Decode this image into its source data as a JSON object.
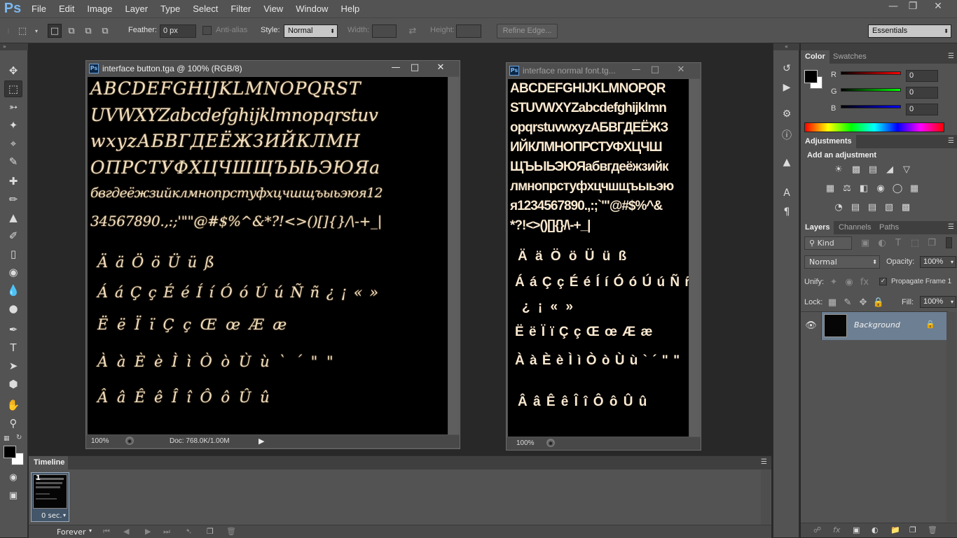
{
  "app": {
    "logo": "Ps"
  },
  "menu": [
    "File",
    "Edit",
    "Image",
    "Layer",
    "Type",
    "Select",
    "Filter",
    "View",
    "Window",
    "Help"
  ],
  "options": {
    "feather_label": "Feather:",
    "feather_value": "0 px",
    "antialias_label": "Anti-alias",
    "style_label": "Style:",
    "style_value": "Normal",
    "width_label": "Width:",
    "height_label": "Height:",
    "refine_edge": "Refine Edge...",
    "workspace": "Essentials"
  },
  "doc1": {
    "title": "interface button.tga @ 100% (RGB/8)",
    "zoom": "100%",
    "doc_info": "Doc: 768.0K/1.00M",
    "lines": [
      "ABCDEFGHIJKLMNOPQRST",
      "UVWXYZabcdefghijklmnopqrstuv",
      "wxyzАБВГДЕЁЖЗИЙКЛМН",
      "ОПРСТУФХЦЧШЩЪЫЬЭЮЯа",
      "бвгдеёжзийклмнопрстуфхцчшщъыьэюя12",
      "34567890.,:;'\"\"@#$%^&*?!<>()[]{}/\\-+_|",
      "Ä ä Ö ö Ü ü ß",
      "Á á Ç ç É é Í í Ó ó Ú ú Ñ ñ ¿ ¡ « »",
      "Ë ë Ï ï Ç ç Œ œ Æ æ",
      "À à È è Ì ì Ò ò Ù ù ` ´ \" \"",
      "Â â Ê ê Î î Ô ô Û û"
    ]
  },
  "doc2": {
    "title": "interface normal font.tg...",
    "zoom": "100%",
    "lines": [
      "ABCDEFGHIJKLMNOPQR",
      "STUVWXYZabcdefghijklmn",
      "opqrstuvwxyzАБВГДЕЁЖЗ",
      "ИЙКЛМНОПРСТУФХЦЧШ",
      "ЩЪЫЬЭЮЯабвгдеёжзийк",
      "лмнопрстуфхцчшщъыьэю",
      "я1234567890.,:;`'\"@#$%^&",
      "*?!<>()[]{}/\\-+_|",
      "Ä ä Ö ö Ü ü ß",
      "Á á Ç ç É é Í í Ó ó Ú ú Ñ ñ",
      "¿ ¡ « »",
      "Ë ë Ï ï Ç ç Œ œ Æ æ",
      "À à È è Ì ì Ò ò Ù ù ` ´ \" \"",
      "Â â Ê ê Î î Ô ô Û û"
    ]
  },
  "timeline": {
    "tab": "Timeline",
    "frame_number": "1",
    "frame_delay": "0 sec.",
    "loop": "Forever"
  },
  "color_panel": {
    "tabs": [
      "Color",
      "Swatches"
    ],
    "r_label": "R",
    "r_value": "0",
    "g_label": "G",
    "g_value": "0",
    "b_label": "B",
    "b_value": "0"
  },
  "adjustments": {
    "tab": "Adjustments",
    "subtitle": "Add an adjustment"
  },
  "layers_panel": {
    "tabs": [
      "Layers",
      "Channels",
      "Paths"
    ],
    "filter": "Kind",
    "blend_mode": "Normal",
    "opacity_label": "Opacity:",
    "opacity_value": "100%",
    "unify_label": "Unify:",
    "propagate": "Propagate Frame 1",
    "lock_label": "Lock:",
    "fill_label": "Fill:",
    "fill_value": "100%",
    "layer_name": "Background"
  },
  "colors": {
    "ps_blue": "#7bb7f0",
    "canvas_text": "#f1dfc0",
    "selected_layer": "#6d7f92"
  }
}
